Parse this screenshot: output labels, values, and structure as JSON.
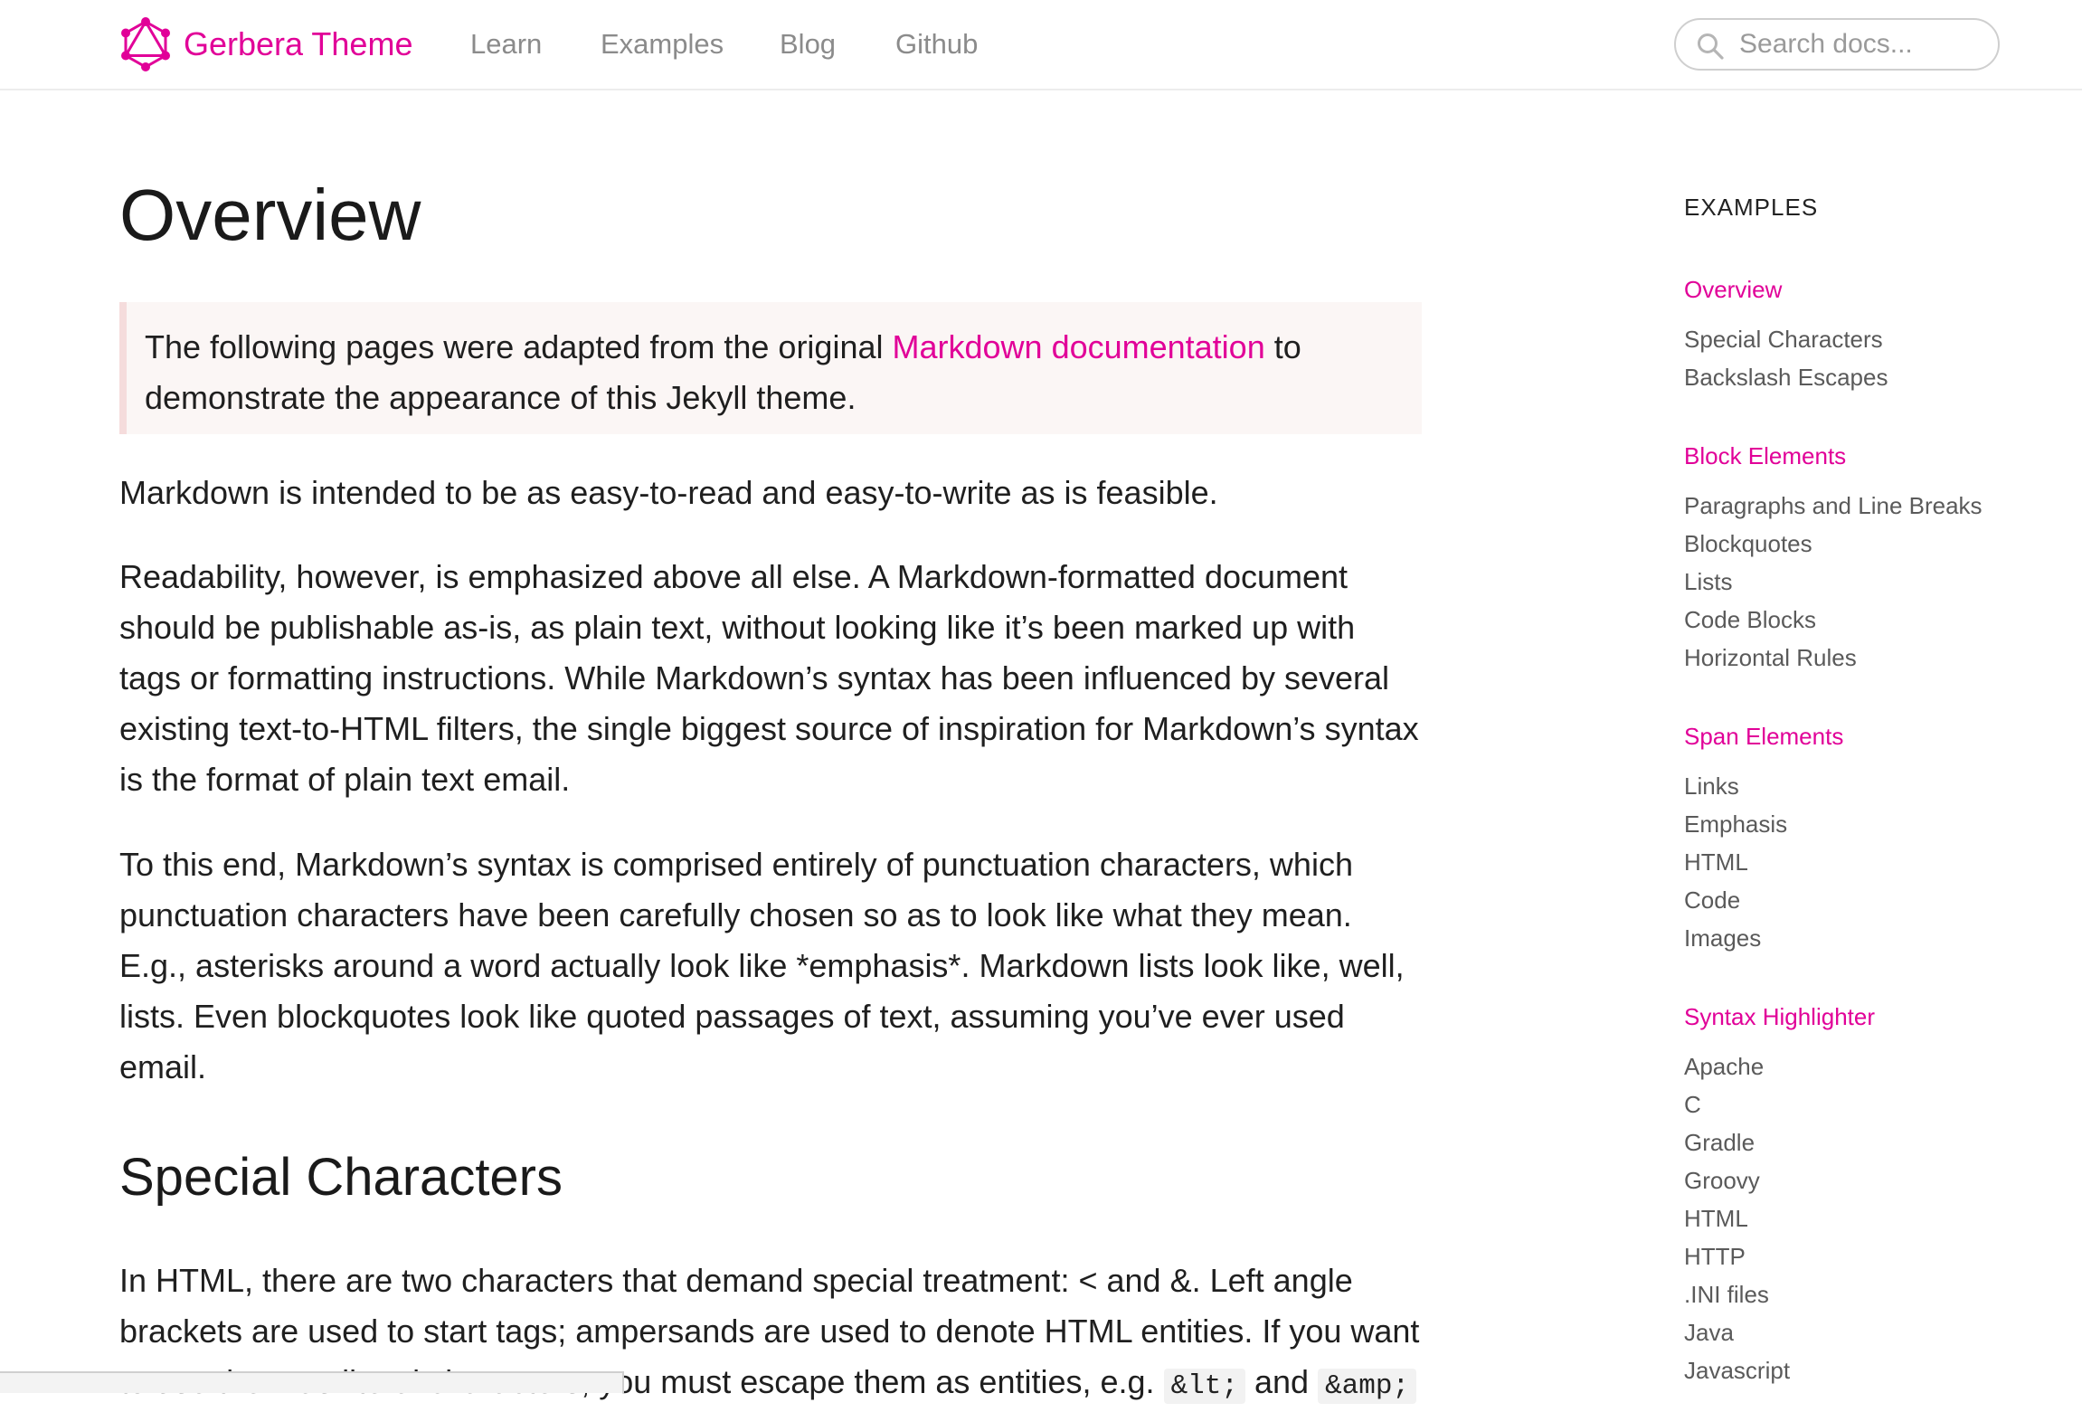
{
  "header": {
    "brand": "Gerbera Theme",
    "nav": [
      "Learn",
      "Examples",
      "Blog",
      "Github"
    ],
    "search_placeholder": "Search docs..."
  },
  "colors": {
    "accent": "#e10098",
    "note_bg": "#fbf6f5",
    "note_border": "#f5dcdc",
    "muted": "#5a5a5a"
  },
  "main": {
    "title": "Overview",
    "note": {
      "before": "The following pages were adapted from the original ",
      "link": "Markdown documentation",
      "after": " to demonstrate the appearance of this Jekyll theme."
    },
    "paragraphs": [
      "Markdown is intended to be as easy-to-read and easy-to-write as is feasible.",
      "Readability, however, is emphasized above all else. A Markdown-formatted document should be publishable as-is, as plain text, without looking like it’s been marked up with tags or formatting instructions. While Markdown’s syntax has been influenced by several existing text-to-HTML filters, the single biggest source of inspiration for Markdown’s syntax is the format of plain text email.",
      "To this end, Markdown’s syntax is comprised entirely of punctuation characters, which punctuation characters have been carefully chosen so as to look like what they mean. E.g., asterisks around a word actually look like *emphasis*. Markdown lists look like, well, lists. Even blockquotes look like quoted passages of text, assuming you’ve ever used email."
    ],
    "section_title": "Special Characters",
    "section_para": {
      "text": "In HTML, there are two characters that demand special treatment: < and &. Left angle brackets are used to start tags; ampersands are used to denote HTML entities. If you want to use them as literal characters, you must escape them as entities, e.g. ",
      "code1": "&lt;",
      "mid": " and ",
      "code2": "&amp;"
    }
  },
  "sidebar": {
    "heading": "EXAMPLES",
    "items": [
      {
        "label": "Overview",
        "accent": true
      },
      {
        "label": "Special Characters",
        "accent": false
      },
      {
        "label": "Backslash Escapes",
        "accent": false
      },
      {
        "label": "Block Elements",
        "accent": true
      },
      {
        "label": "Paragraphs and Line Breaks",
        "accent": false
      },
      {
        "label": "Blockquotes",
        "accent": false
      },
      {
        "label": "Lists",
        "accent": false
      },
      {
        "label": "Code Blocks",
        "accent": false
      },
      {
        "label": "Horizontal Rules",
        "accent": false
      },
      {
        "label": "Span Elements",
        "accent": true
      },
      {
        "label": "Links",
        "accent": false
      },
      {
        "label": "Emphasis",
        "accent": false
      },
      {
        "label": "HTML",
        "accent": false
      },
      {
        "label": "Code",
        "accent": false
      },
      {
        "label": "Images",
        "accent": false
      },
      {
        "label": "Syntax Highlighter",
        "accent": true
      },
      {
        "label": "Apache",
        "accent": false
      },
      {
        "label": "C",
        "accent": false
      },
      {
        "label": "Gradle",
        "accent": false
      },
      {
        "label": "Groovy",
        "accent": false
      },
      {
        "label": "HTML",
        "accent": false
      },
      {
        "label": "HTTP",
        "accent": false
      },
      {
        "label": ".INI files",
        "accent": false
      },
      {
        "label": "Java",
        "accent": false
      },
      {
        "label": "Javascript",
        "accent": false
      }
    ]
  }
}
